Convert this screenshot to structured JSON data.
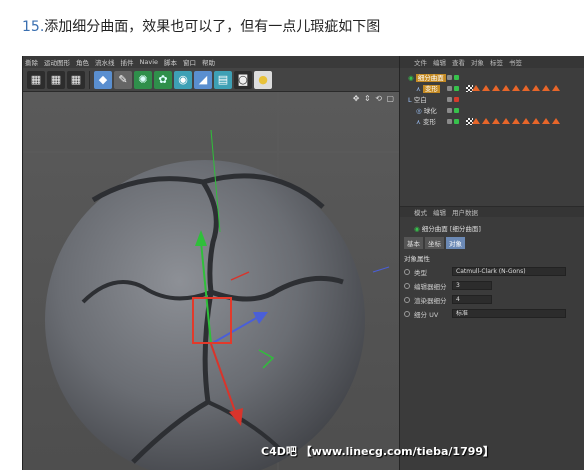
{
  "caption": {
    "number": "15.",
    "text": "添加细分曲面，效果也可以了，但有一点儿瑕疵如下图"
  },
  "menubar": [
    "撕除",
    "运动图形",
    "角色",
    "流水线",
    "插件",
    "Navie",
    "脚本",
    "窗口",
    "帮助"
  ],
  "toolbar": {
    "icons": [
      "film-icon",
      "film-record-icon",
      "film-settings-icon",
      "cube-icon",
      "pen-icon",
      "subdivision-icon",
      "array-icon",
      "deformer-icon",
      "floor-icon",
      "grid-icon",
      "camera-icon",
      "light-icon"
    ]
  },
  "viewport": {
    "nav_icons": "✥ ⇕ ⟲ ▢"
  },
  "object_manager": {
    "header": [
      "文件",
      "编辑",
      "查看",
      "对象",
      "标签",
      "书签"
    ],
    "rows": [
      {
        "name": "细分曲面",
        "indent": 0
      },
      {
        "name": "变形",
        "indent": 1
      },
      {
        "name": "空白",
        "indent": 0
      },
      {
        "name": "球化",
        "indent": 1
      },
      {
        "name": "变形",
        "indent": 1
      }
    ]
  },
  "attributes": {
    "header": [
      "模式",
      "编辑",
      "用户数据"
    ],
    "title": "细分曲面 [细分曲面]",
    "tabs": [
      "基本",
      "坐标",
      "对象"
    ],
    "active_tab": "对象",
    "section": "对象属性",
    "properties": [
      {
        "label": "类型",
        "value": "Catmull-Clark (N-Gons)"
      },
      {
        "label": "编辑器细分",
        "value": "3"
      },
      {
        "label": "渲染器细分",
        "value": "4"
      },
      {
        "label": "细分 UV",
        "value": "标准"
      }
    ]
  },
  "watermark": "C4D吧 【www.linecg.com/tieba/1799】",
  "colors": {
    "app_bg": "#3b3b3b",
    "viewport_bg": "#565656",
    "highlight_box": "#e23a2b",
    "axis_green": "#2fbf3a",
    "axis_red": "#d9342b",
    "axis_blue": "#4a5fd8"
  }
}
